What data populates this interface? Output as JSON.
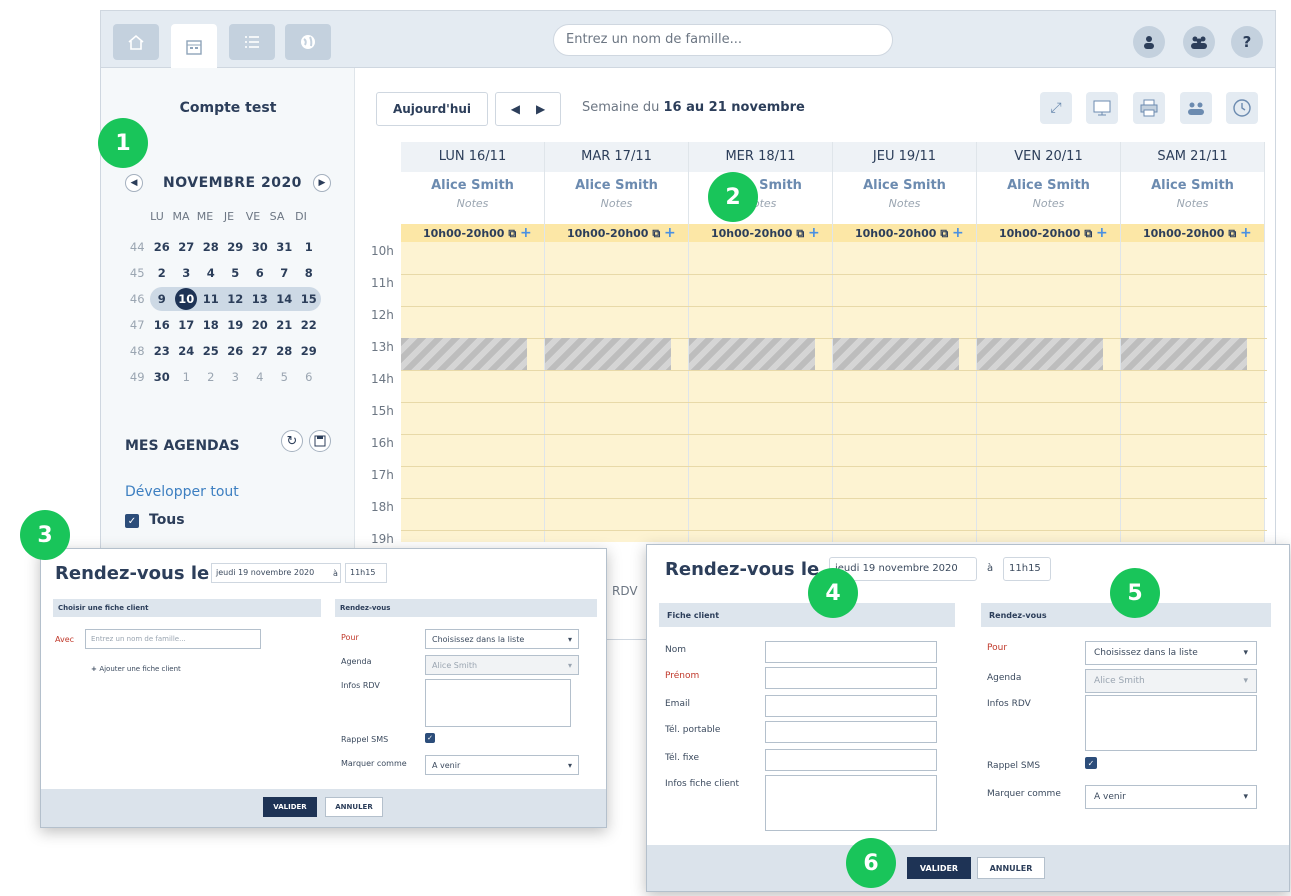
{
  "toolbar": {
    "search_placeholder": "Entrez un nom de famille...",
    "help": "?"
  },
  "sidebar": {
    "account": "Compte test",
    "month": "NOVEMBRE 2020",
    "days": [
      "LU",
      "MA",
      "ME",
      "JE",
      "VE",
      "SA",
      "DI"
    ],
    "weeks": [
      [
        "44",
        "26",
        "27",
        "28",
        "29",
        "30",
        "31",
        "1"
      ],
      [
        "45",
        "2",
        "3",
        "4",
        "5",
        "6",
        "7",
        "8"
      ],
      [
        "46",
        "9",
        "10",
        "11",
        "12",
        "13",
        "14",
        "15"
      ],
      [
        "47",
        "16",
        "17",
        "18",
        "19",
        "20",
        "21",
        "22"
      ],
      [
        "48",
        "23",
        "24",
        "25",
        "26",
        "27",
        "28",
        "29"
      ],
      [
        "49",
        "30",
        "1",
        "2",
        "3",
        "4",
        "5",
        "6"
      ]
    ],
    "agendas_title": "MES AGENDAS",
    "expand": "Développer tout",
    "all": "Tous"
  },
  "main": {
    "today": "Aujourd'hui",
    "week_prefix": "Semaine du ",
    "week_range": "16 au 21 novembre",
    "columns": [
      {
        "day": "LUN 16/11",
        "person": "Alice Smith",
        "notes": "Notes",
        "slot": "10h00-20h00"
      },
      {
        "day": "MAR 17/11",
        "person": "Alice Smith",
        "notes": "Notes",
        "slot": "10h00-20h00"
      },
      {
        "day": "MER 18/11",
        "person": "Alice Smith",
        "notes": "Notes",
        "slot": "10h00-20h00"
      },
      {
        "day": "JEU 19/11",
        "person": "Alice Smith",
        "notes": "Notes",
        "slot": "10h00-20h00"
      },
      {
        "day": "VEN 20/11",
        "person": "Alice Smith",
        "notes": "Notes",
        "slot": "10h00-20h00"
      },
      {
        "day": "SAM 21/11",
        "person": "Alice Smith",
        "notes": "Notes",
        "slot": "10h00-20h00"
      }
    ],
    "hours": [
      "10h",
      "11h",
      "12h",
      "13h",
      "14h",
      "15h",
      "16h",
      "17h",
      "18h",
      "19h"
    ],
    "rdv": "RDV"
  },
  "modal_small": {
    "title": "Rendez-vous le",
    "date": "jeudi 19 novembre 2020",
    "a": "à",
    "time": "11h15",
    "client_section": "Choisir une fiche client",
    "rdv_section": "Rendez-vous",
    "avec": "Avec",
    "search_placeholder": "Entrez un nom de famille...",
    "add_client": "Ajouter une fiche client",
    "pour": "Pour",
    "pour_value": "Choisissez dans la liste",
    "agenda": "Agenda",
    "agenda_value": "Alice Smith",
    "infos": "Infos RDV",
    "sms": "Rappel SMS",
    "marquer": "Marquer comme",
    "marquer_value": "A venir",
    "valider": "VALIDER",
    "annuler": "ANNULER"
  },
  "modal_big": {
    "title": "Rendez-vous le",
    "date": "jeudi 19 novembre 2020",
    "a": "à",
    "time": "11h15",
    "client_section": "Fiche client",
    "rdv_section": "Rendez-vous",
    "nom": "Nom",
    "prenom": "Prénom",
    "email": "Email",
    "tel_port": "Tél. portable",
    "tel_fixe": "Tél. fixe",
    "infos_client": "Infos fiche client",
    "pour": "Pour",
    "pour_value": "Choisissez dans la liste",
    "agenda": "Agenda",
    "agenda_value": "Alice Smith",
    "infos": "Infos RDV",
    "sms": "Rappel SMS",
    "marquer": "Marquer comme",
    "marquer_value": "A venir",
    "valider": "VALIDER",
    "annuler": "ANNULER"
  },
  "badges": [
    "1",
    "2",
    "3",
    "4",
    "5",
    "6"
  ]
}
